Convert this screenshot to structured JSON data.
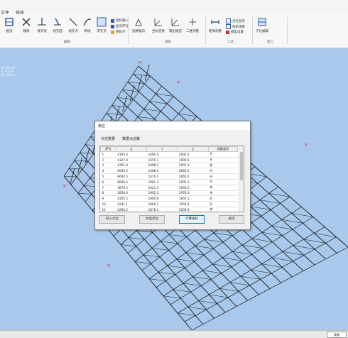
{
  "menubar": {
    "items": [
      "文件",
      "修改"
    ]
  },
  "ribbon": {
    "buttons": [
      {
        "label": "框选",
        "icon": "frame-select-icon"
      },
      {
        "label": "删除",
        "icon": "delete-icon"
      },
      {
        "label": "线交线",
        "icon": "line-intersect-icon"
      },
      {
        "label": "线交面",
        "icon": "line-plane-icon"
      },
      {
        "label": "线交点",
        "icon": "line-point-icon"
      },
      {
        "label": "断线",
        "icon": "break-line-icon"
      },
      {
        "label": "求交点",
        "icon": "intersection-point-icon"
      },
      {
        "label": "选换轴向",
        "icon": "axis-icon"
      },
      {
        "label": "坐标变换",
        "icon": "transform-icon"
      },
      {
        "label": "输出模型",
        "icon": "export-model-icon"
      },
      {
        "label": "二维测量",
        "icon": "measure-2d-icon"
      },
      {
        "label": "距离测量",
        "icon": "distance-icon"
      },
      {
        "label": "点位编辑",
        "icon": "point-edit-icon"
      }
    ],
    "small_buttons": [
      "坐标输入",
      "显示序号",
      "更新点"
    ],
    "small_buttons2": [
      "点位显示",
      "线条测距",
      "模型设置"
    ],
    "groups": [
      "编辑",
      "辅助",
      "工具",
      "窗口"
    ]
  },
  "viewport": {
    "coords": [
      "X: 0.1 m",
      "Y: 0.2 m",
      "Z: 0.0 m"
    ]
  },
  "dialog": {
    "title": "点位",
    "field_label": "点位数量",
    "field_value": "数据点总数",
    "columns": [
      "序号",
      "X",
      "Y",
      "Z",
      "测量类型"
    ],
    "rows": [
      [
        "1",
        "4305.0",
        "1460.5",
        "2002.4",
        "开"
      ],
      [
        "2",
        "4327.0",
        "1555.1",
        "1990.5",
        "开"
      ],
      [
        "3",
        "4351.0",
        "1488.2",
        "2001.3",
        "关"
      ],
      [
        "4",
        "8000.5",
        "1468.0",
        "2065.0",
        "开"
      ],
      [
        "5",
        "8000.5",
        "1470.2",
        "2065.0",
        "开"
      ],
      [
        "6",
        "8000.5",
        "1981.3",
        "2005.1",
        "开"
      ],
      [
        "7",
        "3879.5",
        "1921.4",
        "1993.6",
        "关"
      ],
      [
        "8",
        "3858.0",
        "1902.3",
        "1978.3",
        "关"
      ],
      [
        "9",
        "4205.5",
        "1900.6",
        "1907.1",
        "开"
      ],
      [
        "10",
        "4241.1",
        "1860.2",
        "1902.4",
        "开"
      ],
      [
        "11",
        "4256.2",
        "1876.4",
        "2005.0",
        "关"
      ],
      [
        "12",
        "4270.1",
        "1905.5",
        "1909.8",
        "开"
      ]
    ],
    "buttons": [
      "导入点位",
      "导出点位",
      "计算坐标",
      "关闭"
    ]
  },
  "statusbar": {
    "text": "就绪"
  },
  "colors": {
    "viewport_bg": "#a9c8ec",
    "wire": "#1a1a1a",
    "marker": "#e03030"
  }
}
